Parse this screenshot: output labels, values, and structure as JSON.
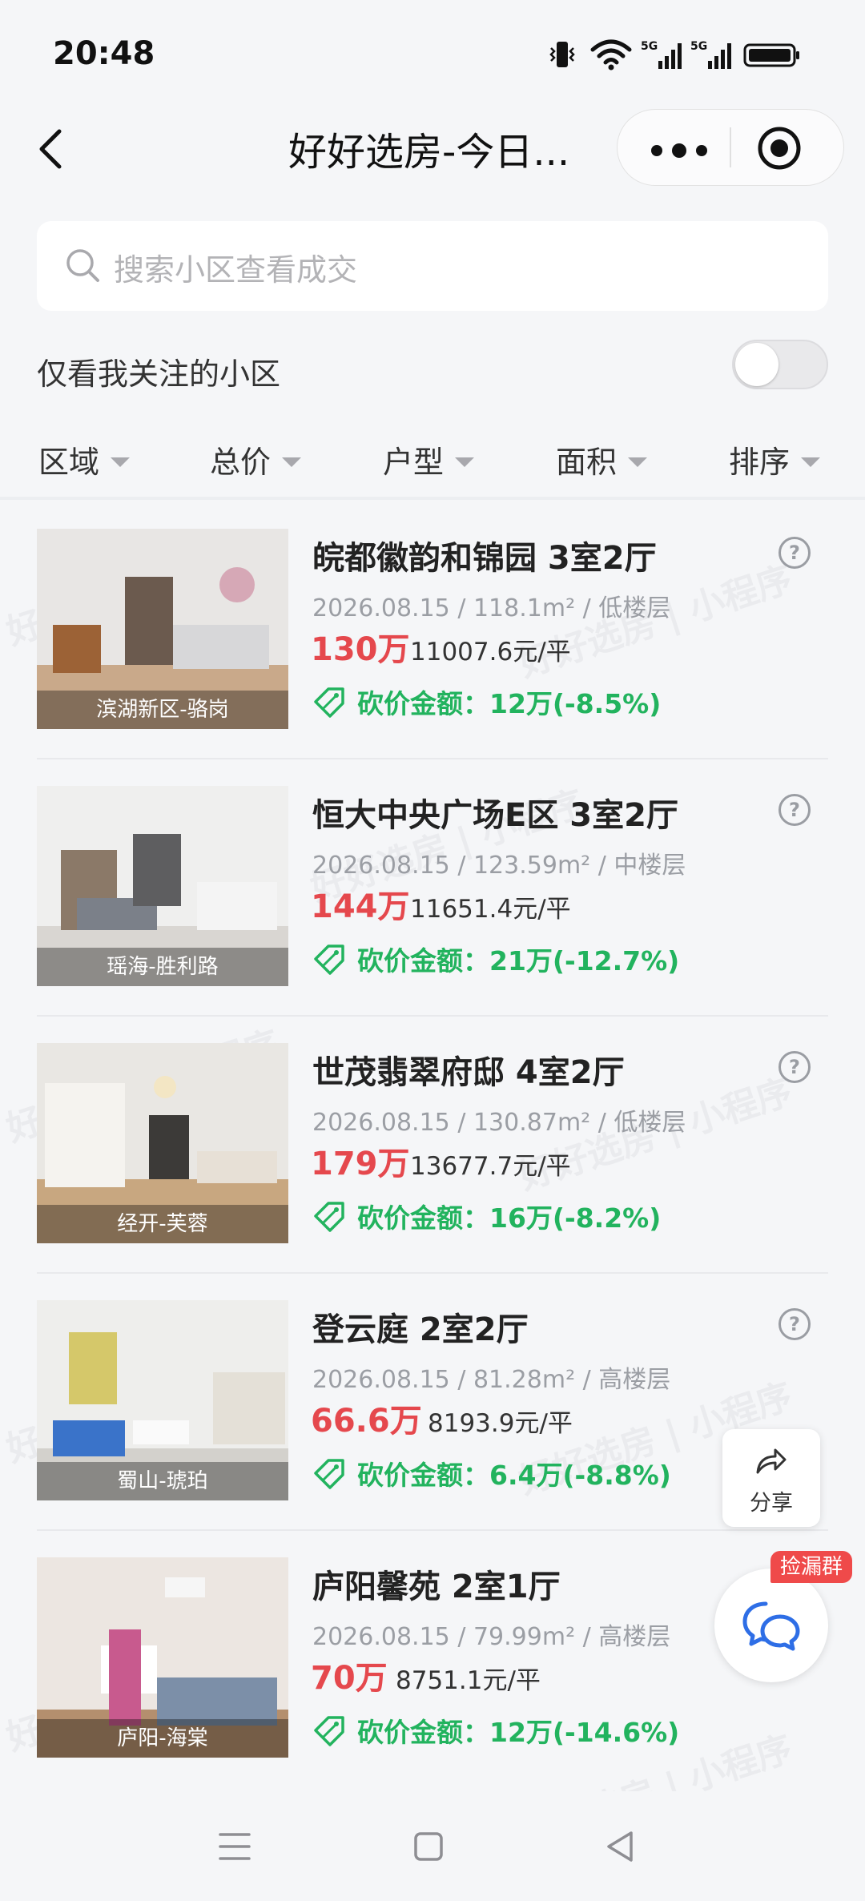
{
  "status_bar": {
    "time": "20:48"
  },
  "nav": {
    "title": "好好选房-今日..."
  },
  "search": {
    "placeholder": "搜索小区查看成交"
  },
  "follow_filter": {
    "label": "仅看我关注的小区",
    "enabled": false
  },
  "filters": [
    "区域",
    "总价",
    "户型",
    "面积",
    "排序"
  ],
  "watermark": "好好选房 | 小程序",
  "listings": [
    {
      "location": "滨湖新区-骆岗",
      "title": "皖都徽韵和锦园 3室2厅",
      "date": "2026.08.15",
      "area": "118.1m²",
      "floor": "低楼层",
      "price": "130万",
      "unit_price": "11007.6元/平",
      "cut": "砍价金额：12万(-8.5%)"
    },
    {
      "location": "瑶海-胜利路",
      "title": "恒大中央广场E区 3室2厅",
      "date": "2026.08.15",
      "area": "123.59m²",
      "floor": "中楼层",
      "price": "144万",
      "unit_price": "11651.4元/平",
      "cut": "砍价金额：21万(-12.7%)"
    },
    {
      "location": "经开-芙蓉",
      "title": "世茂翡翠府邸 4室2厅",
      "date": "2026.08.15",
      "area": "130.87m²",
      "floor": "低楼层",
      "price": "179万",
      "unit_price": "13677.7元/平",
      "cut": "砍价金额：16万(-8.2%)"
    },
    {
      "location": "蜀山-琥珀",
      "title": "登云庭 2室2厅",
      "date": "2026.08.15",
      "area": "81.28m²",
      "floor": "高楼层",
      "price": "66.6万",
      "unit_price": "8193.9元/平",
      "cut": "砍价金额：6.4万(-8.8%)"
    },
    {
      "location": "庐阳-海棠",
      "title": "庐阳馨苑 2室1厅",
      "date": "2026.08.15",
      "area": "79.99m²",
      "floor": "高楼层",
      "price": "70万",
      "unit_price": "8751.1元/平",
      "cut": "砍价金额：12万(-14.6%)"
    }
  ],
  "floating": {
    "share_label": "分享",
    "chat_badge": "捡漏群"
  },
  "colors": {
    "price": "#e5484d",
    "cut": "#22b35e",
    "badge": "#ef4a4a"
  }
}
